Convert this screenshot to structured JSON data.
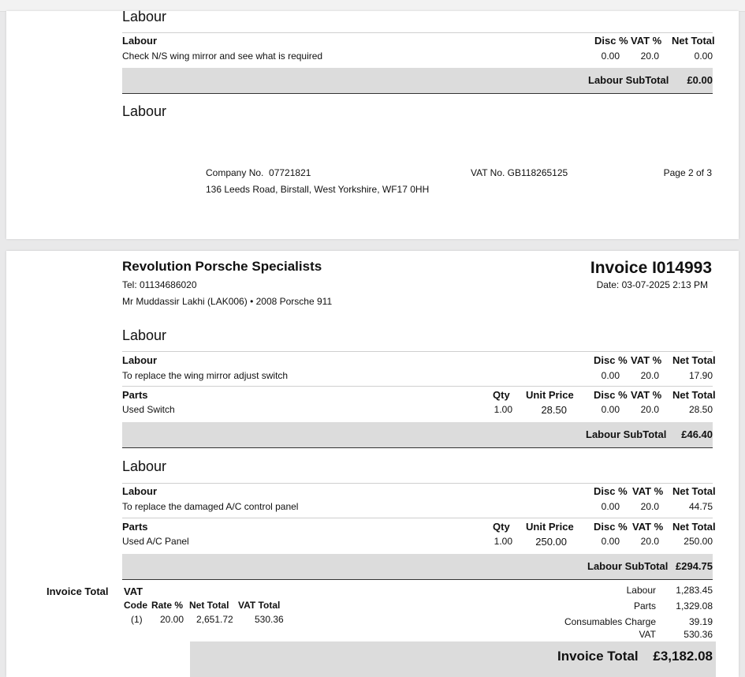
{
  "page1": {
    "section_title": "Labour",
    "labour_header": "Labour",
    "col_disc": "Disc %",
    "col_vat": "VAT %",
    "col_net": "Net Total",
    "item_desc": "Check N/S wing mirror and see what is required",
    "item_disc": "0.00",
    "item_vat": "20.0",
    "item_net": "0.00",
    "subtotal_label": "Labour SubTotal",
    "subtotal_value": "£0.00",
    "section_title_2": "Labour",
    "footer": {
      "company_no": "Company No.  07721821",
      "vat_no": "VAT No. GB118265125",
      "page": "Page 2 of 3",
      "address": "136 Leeds Road, Birstall, West Yorkshire, WF17 0HH"
    }
  },
  "page2": {
    "company": "Revolution Porsche Specialists",
    "tel": "Tel: 01134686020",
    "customer": "Mr Muddassir Lakhi (LAK006) • 2008 Porsche 911",
    "invoice_no": "Invoice I014993",
    "date": "Date: 03-07-2025 2:13 PM",
    "blocks": [
      {
        "title": "Labour",
        "labour_header": "Labour",
        "col_disc": "Disc %",
        "col_vat": "VAT %",
        "col_net": "Net Total",
        "labour_desc": "To replace the wing mirror adjust switch",
        "labour_disc": "0.00",
        "labour_vat": "20.0",
        "labour_net": "17.90",
        "parts_header": "Parts",
        "col_qty": "Qty",
        "col_unit": "Unit Price",
        "part_desc": "Used Switch",
        "part_qty": "1.00",
        "part_unit": "28.50",
        "part_disc": "0.00",
        "part_vat": "20.0",
        "part_net": "28.50",
        "subtotal_label": "Labour SubTotal",
        "subtotal_value": "£46.40"
      },
      {
        "title": "Labour",
        "labour_header": "Labour",
        "col_disc": "Disc %",
        "col_vat": "VAT %",
        "col_net": "Net Total",
        "labour_desc": "To replace the damaged A/C control panel",
        "labour_disc": "0.00",
        "labour_vat": "20.0",
        "labour_net": "44.75",
        "parts_header": "Parts",
        "col_qty": "Qty",
        "col_unit": "Unit Price",
        "part_desc": "Used A/C Panel",
        "part_qty": "1.00",
        "part_unit": "250.00",
        "part_disc": "0.00",
        "part_vat": "20.0",
        "part_net": "250.00",
        "subtotal_label": "Labour SubTotal",
        "subtotal_value": "£294.75"
      }
    ],
    "totals": {
      "side_label": "Invoice Total",
      "vat_title": "VAT",
      "vat_headers": [
        "Code",
        "Rate %",
        "Net Total",
        "VAT Total"
      ],
      "vat_row": [
        "(1)",
        "20.00",
        "2,651.72",
        "530.36"
      ],
      "summary": [
        {
          "label": "Labour",
          "value": "1,283.45"
        },
        {
          "label": "Parts",
          "value": "1,329.08"
        },
        {
          "label": "Consumables Charge",
          "value": "39.19"
        },
        {
          "label": "VAT",
          "value": "530.36"
        }
      ],
      "grand_label": "Invoice Total",
      "grand_value": "£3,182.08"
    }
  }
}
